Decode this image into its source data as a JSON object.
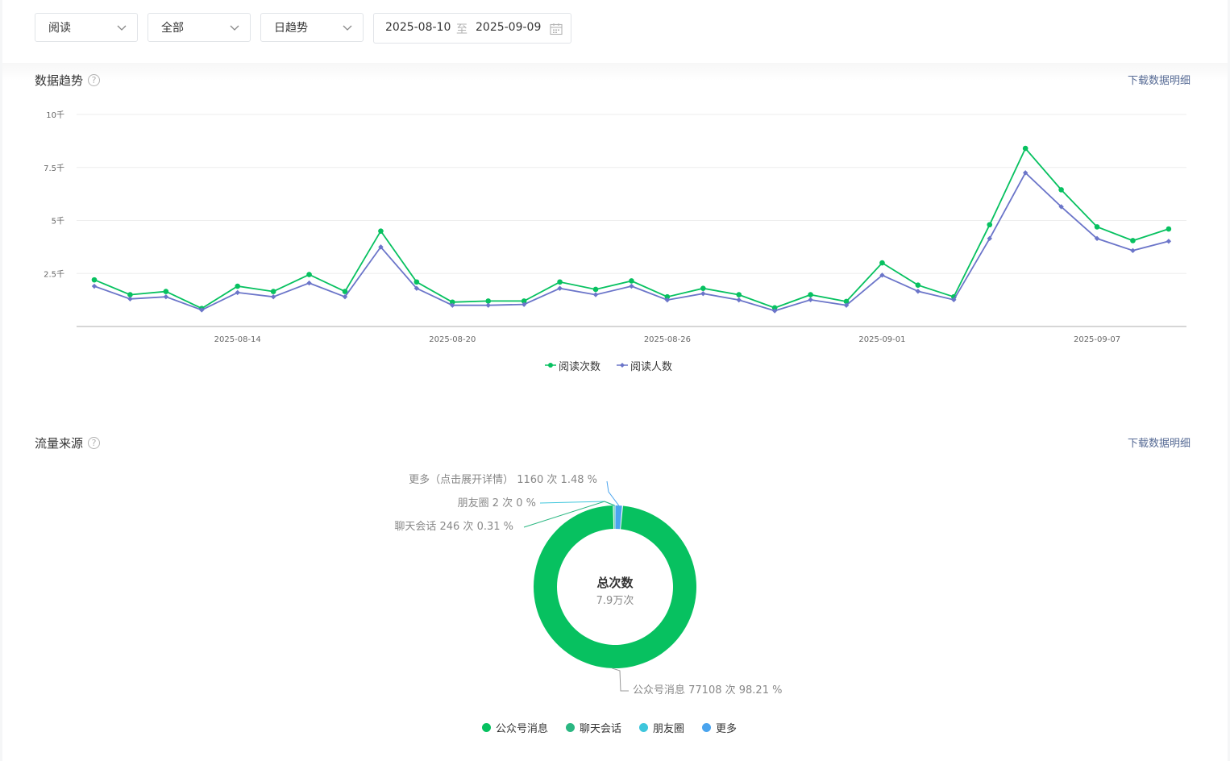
{
  "filters": {
    "metric": "阅读",
    "scope": "全部",
    "granularity": "日趋势",
    "date_start": "2025-08-10",
    "date_sep": "至",
    "date_end": "2025-09-09"
  },
  "icons": {
    "chevron": "chevron-down-icon",
    "calendar": "calendar-icon",
    "help": "help-icon"
  },
  "trend": {
    "title": "数据趋势",
    "help": "?",
    "download": "下载数据明细"
  },
  "source": {
    "title": "流量来源",
    "help": "?",
    "download": "下载数据明细",
    "center_title": "总次数",
    "center_value": "7.9万次",
    "labels": {
      "more": "更多（点击展开详情） 1160 次 1.48 %",
      "moments": "朋友圈 2 次 0 %",
      "chat": "聊天会话 246 次 0.31 %",
      "msg": "公众号消息 77108 次 98.21 %"
    },
    "legend": [
      "公众号消息",
      "聊天会话",
      "朋友圈",
      "更多"
    ]
  },
  "colors": {
    "reads": "#07c160",
    "readers": "#6b75c9",
    "msg": "#07c160",
    "chat": "#2bb782",
    "moments": "#3ec6dc",
    "more": "#4aa4ee",
    "link": "#576b95"
  },
  "chart_data": [
    {
      "type": "line",
      "x": [
        "2025-08-10",
        "2025-08-11",
        "2025-08-12",
        "2025-08-13",
        "2025-08-14",
        "2025-08-15",
        "2025-08-16",
        "2025-08-17",
        "2025-08-18",
        "2025-08-19",
        "2025-08-20",
        "2025-08-21",
        "2025-08-22",
        "2025-08-23",
        "2025-08-24",
        "2025-08-25",
        "2025-08-26",
        "2025-08-27",
        "2025-08-28",
        "2025-08-29",
        "2025-08-30",
        "2025-08-31",
        "2025-09-01",
        "2025-09-02",
        "2025-09-03",
        "2025-09-04",
        "2025-09-05",
        "2025-09-06",
        "2025-09-07",
        "2025-09-08",
        "2025-09-09"
      ],
      "xticks": [
        "2025-08-14",
        "2025-08-20",
        "2025-08-26",
        "2025-09-01",
        "2025-09-07"
      ],
      "yticks": [
        "2.5千",
        "5千",
        "7.5千",
        "10千"
      ],
      "ylim": [
        0,
        10000
      ],
      "grid": true,
      "legend": "bottom",
      "series": [
        {
          "name": "阅读次数",
          "values": [
            2200,
            1500,
            1650,
            850,
            1900,
            1650,
            2450,
            1650,
            4500,
            2100,
            1150,
            1200,
            1200,
            2100,
            1750,
            2150,
            1400,
            1800,
            1500,
            880,
            1500,
            1180,
            3000,
            1950,
            1400,
            4800,
            8400,
            6450,
            4700,
            4050,
            4600
          ]
        },
        {
          "name": "阅读人数",
          "values": [
            1900,
            1300,
            1400,
            780,
            1600,
            1400,
            2050,
            1400,
            3750,
            1800,
            1000,
            1000,
            1040,
            1800,
            1500,
            1900,
            1250,
            1550,
            1250,
            740,
            1260,
            1000,
            2420,
            1660,
            1260,
            4150,
            7250,
            5650,
            4150,
            3580,
            4020
          ]
        }
      ]
    },
    {
      "type": "pie",
      "categories": [
        "公众号消息",
        "聊天会话",
        "朋友圈",
        "更多（点击展开详情）"
      ],
      "values": [
        77108,
        246,
        2,
        1160
      ],
      "percent": [
        98.21,
        0.31,
        0,
        1.48
      ]
    }
  ]
}
